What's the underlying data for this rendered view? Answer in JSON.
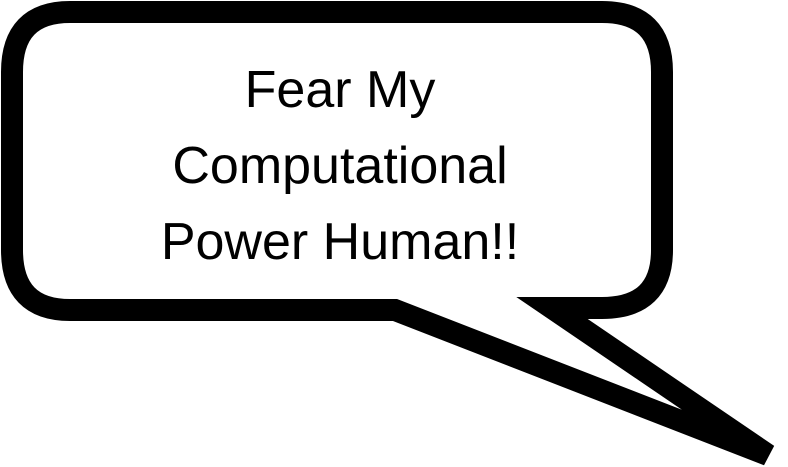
{
  "speech_bubble": {
    "lines": [
      "Fear My",
      "Computational",
      "Power Human!!"
    ],
    "colors": {
      "outline": "#000000",
      "fill": "#ffffff",
      "text": "#000000"
    }
  }
}
